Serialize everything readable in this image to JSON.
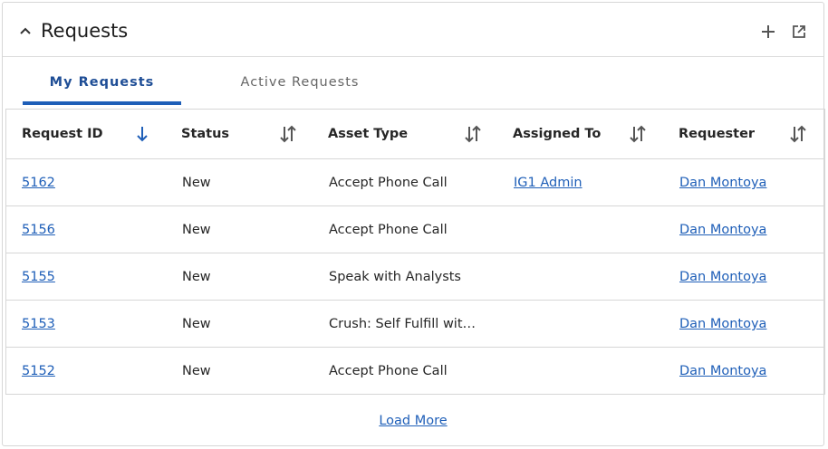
{
  "header": {
    "title": "Requests",
    "collapse_icon": "chevron-up-icon",
    "add_icon": "plus-icon",
    "popout_icon": "external-link-icon"
  },
  "tabs": [
    {
      "label": "My Requests",
      "active": true
    },
    {
      "label": "Active Requests",
      "active": false
    }
  ],
  "table": {
    "columns": [
      {
        "label": "Request ID",
        "sort": "descending"
      },
      {
        "label": "Status",
        "sort": "none"
      },
      {
        "label": "Asset Type",
        "sort": "none"
      },
      {
        "label": "Assigned To",
        "sort": "none"
      },
      {
        "label": "Requester",
        "sort": "none"
      }
    ],
    "rows": [
      {
        "id": "5162",
        "status": "New",
        "asset_type": "Accept Phone Call",
        "assigned_to": "IG1 Admin",
        "requester": "Dan Montoya"
      },
      {
        "id": "5156",
        "status": "New",
        "asset_type": "Accept Phone Call",
        "assigned_to": "",
        "requester": "Dan Montoya"
      },
      {
        "id": "5155",
        "status": "New",
        "asset_type": "Speak with Analysts",
        "assigned_to": "",
        "requester": "Dan Montoya"
      },
      {
        "id": "5153",
        "status": "New",
        "asset_type": "Crush: Self Fulfill wit…",
        "assigned_to": "",
        "requester": "Dan Montoya"
      },
      {
        "id": "5152",
        "status": "New",
        "asset_type": "Accept Phone Call",
        "assigned_to": "",
        "requester": "Dan Montoya"
      }
    ]
  },
  "footer": {
    "load_more": "Load More"
  },
  "colors": {
    "accent": "#1f5fb8",
    "tab_active": "#1f4e96",
    "border": "#d6d6d6"
  }
}
